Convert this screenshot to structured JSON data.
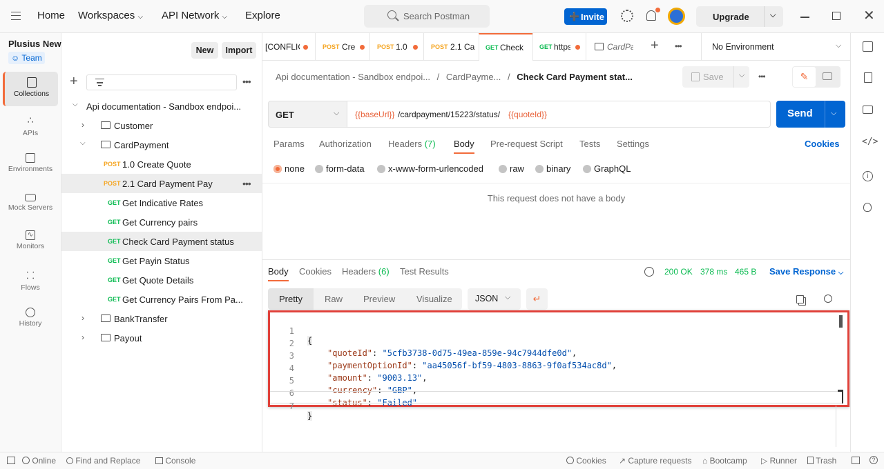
{
  "topbar": {
    "home": "Home",
    "workspaces": "Workspaces",
    "api_network": "API Network",
    "explore": "Explore",
    "search_placeholder": "Search Postman",
    "invite": "Invite",
    "upgrade": "Upgrade"
  },
  "workspace": {
    "name": "Plusius New",
    "team": "Team",
    "new_btn": "New",
    "import_btn": "Import"
  },
  "rail": [
    {
      "label": "Collections",
      "icon": "collections-icon"
    },
    {
      "label": "APIs",
      "icon": "apis-icon"
    },
    {
      "label": "Environments",
      "icon": "environments-icon"
    },
    {
      "label": "Mock Servers",
      "icon": "mock-servers-icon"
    },
    {
      "label": "Monitors",
      "icon": "monitors-icon"
    },
    {
      "label": "Flows",
      "icon": "flows-icon"
    },
    {
      "label": "History",
      "icon": "history-icon"
    }
  ],
  "tree": {
    "collection": "Api documentation - Sandbox endpoi...",
    "customer": "Customer",
    "cardpayment": "CardPayment",
    "items": [
      {
        "method": "POST",
        "name": "1.0 Create Quote"
      },
      {
        "method": "POST",
        "name": "2.1 Card Payment Pay"
      },
      {
        "method": "GET",
        "name": "Get Indicative Rates"
      },
      {
        "method": "GET",
        "name": "Get Currency pairs"
      },
      {
        "method": "GET",
        "name": "Check Card Payment status"
      },
      {
        "method": "GET",
        "name": "Get Payin Status"
      },
      {
        "method": "GET",
        "name": "Get Quote Details"
      },
      {
        "method": "GET",
        "name": "Get Currency Pairs From Pa..."
      }
    ],
    "banktransfer": "BankTransfer",
    "payout": "Payout"
  },
  "tabs": [
    {
      "method": "",
      "name": "[CONFLICT]"
    },
    {
      "method": "POST",
      "name": "Cre"
    },
    {
      "method": "POST",
      "name": "1.0"
    },
    {
      "method": "POST",
      "name": "2.1 Ca"
    },
    {
      "method": "GET",
      "name": "Check"
    },
    {
      "method": "GET",
      "name": "https"
    },
    {
      "method": "",
      "name": "CardPa"
    }
  ],
  "environment": "No Environment",
  "breadcrumb": {
    "part1": "Api documentation - Sandbox endpoi...",
    "part2": "CardPayme...",
    "current": "Check Card Payment stat...",
    "sep": "/"
  },
  "save": "Save",
  "request": {
    "method": "GET",
    "url_var1": "{{baseUrl}}",
    "url_path": "/cardpayment/15223/status/",
    "url_var2": "{{quoteId}}",
    "send": "Send"
  },
  "req_tabs": {
    "params": "Params",
    "authorization": "Authorization",
    "headers": "Headers",
    "headers_count": "(7)",
    "body": "Body",
    "prerequest": "Pre-request Script",
    "tests": "Tests",
    "settings": "Settings",
    "cookies": "Cookies"
  },
  "body_types": [
    "none",
    "form-data",
    "x-www-form-urlencoded",
    "raw",
    "binary",
    "GraphQL"
  ],
  "no_body": "This request does not have a body",
  "response": {
    "tab_body": "Body",
    "tab_cookies": "Cookies",
    "tab_headers": "Headers",
    "headers_count": "(6)",
    "tab_tests": "Test Results",
    "status": "200 OK",
    "time": "378 ms",
    "size": "465 B",
    "save_response": "Save Response",
    "views": [
      "Pretty",
      "Raw",
      "Preview",
      "Visualize"
    ],
    "format": "JSON"
  },
  "code_lines": [
    {
      "n": "1",
      "key": "",
      "val": "",
      "text": "{"
    },
    {
      "n": "2",
      "key": "\"quoteId\"",
      "val": "\"5cfb3738-0d75-49ea-859e-94c7944dfe0d\"",
      "text": ","
    },
    {
      "n": "3",
      "key": "\"paymentOptionId\"",
      "val": "\"aa45056f-bf59-4803-8863-9f0af534ac8d\"",
      "text": ","
    },
    {
      "n": "4",
      "key": "\"amount\"",
      "val": "\"9003.13\"",
      "text": ","
    },
    {
      "n": "5",
      "key": "\"currency\"",
      "val": "\"GBP\"",
      "text": ","
    },
    {
      "n": "6",
      "key": "\"status\"",
      "val": "\"Failed\"",
      "text": ""
    },
    {
      "n": "7",
      "key": "",
      "val": "",
      "text": "}"
    }
  ],
  "statusbar": {
    "online": "Online",
    "find_replace": "Find and Replace",
    "console": "Console",
    "cookies": "Cookies",
    "capture": "Capture requests",
    "bootcamp": "Bootcamp",
    "runner": "Runner",
    "trash": "Trash"
  },
  "colors": {
    "accent": "#0265d2",
    "orange": "#f26b3a",
    "highlight_border": "#e0413a",
    "status_ok": "#0cbb52"
  }
}
